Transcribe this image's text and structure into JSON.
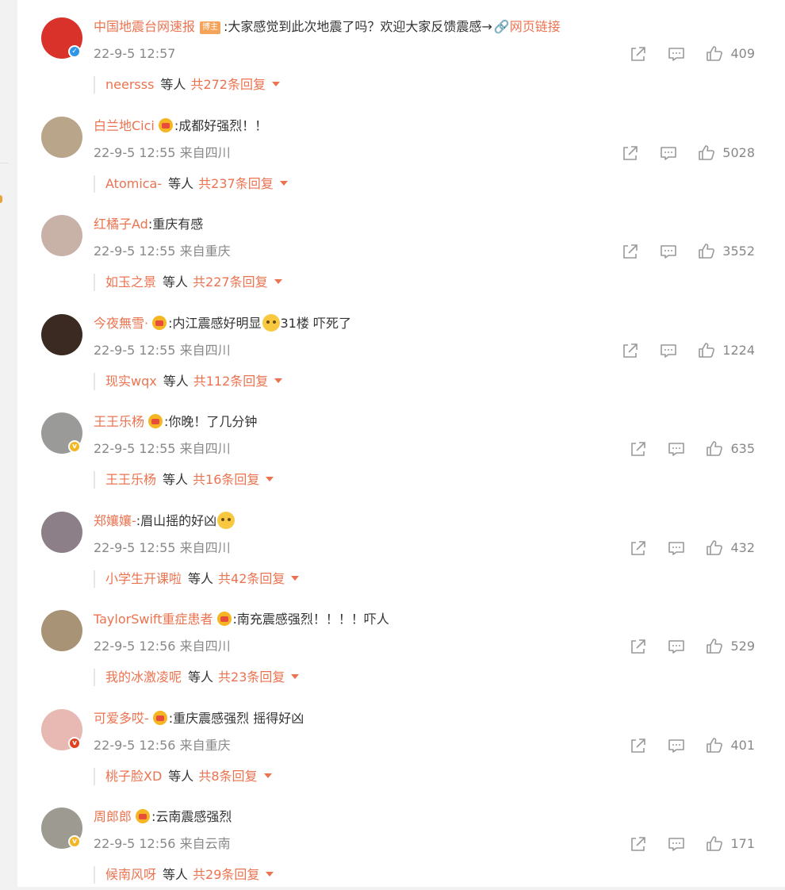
{
  "comments": [
    {
      "user": "中国地震台网速报",
      "tag": "博主",
      "text": ":大家感觉到此次地震了吗？欢迎大家反馈震感→",
      "link": "网页链接",
      "time": "22-9-5 12:57",
      "location": "",
      "likes": "409",
      "reply_user": "neersss",
      "reply_mid": "等人",
      "reply_total": "共272条回复",
      "badge": "blue",
      "crown": false,
      "avatar_color": "#d8322b"
    },
    {
      "user": "白兰地Cici",
      "tag": "",
      "text": ":成都好强烈！！",
      "link": "",
      "time": "22-9-5 12:55",
      "location": "来自四川",
      "likes": "5028",
      "reply_user": "Atomica-",
      "reply_mid": "等人",
      "reply_total": "共237条回复",
      "badge": "",
      "crown": true,
      "avatar_color": "#b9a58a"
    },
    {
      "user": "红橘子Ad",
      "tag": "",
      "text": ":重庆有感",
      "link": "",
      "time": "22-9-5 12:55",
      "location": "来自重庆",
      "likes": "3552",
      "reply_user": "如玉之景",
      "reply_mid": "等人",
      "reply_total": "共227条回复",
      "badge": "",
      "crown": false,
      "avatar_color": "#c8b2a8"
    },
    {
      "user": "今夜無雪·",
      "tag": "",
      "text": ":内江震感好明显",
      "text2": "31楼 吓死了",
      "link": "",
      "time": "22-9-5 12:55",
      "location": "来自四川",
      "likes": "1224",
      "reply_user": "现实wqx",
      "reply_mid": "等人",
      "reply_total": "共112条回复",
      "badge": "",
      "crown": true,
      "emoji": true,
      "avatar_color": "#3a2a22"
    },
    {
      "user": "王王乐杨",
      "tag": "",
      "text": ":你晚！了几分钟",
      "link": "",
      "time": "22-9-5 12:55",
      "location": "来自四川",
      "likes": "635",
      "reply_user": "王王乐杨",
      "reply_mid": "等人",
      "reply_total": "共16条回复",
      "badge": "gold",
      "crown": true,
      "avatar_color": "#9a9a98"
    },
    {
      "user": "郑孃孃-",
      "tag": "",
      "text": ":眉山摇的好凶",
      "link": "",
      "time": "22-9-5 12:55",
      "location": "来自四川",
      "likes": "432",
      "reply_user": "小学生开课啦",
      "reply_mid": "等人",
      "reply_total": "共42条回复",
      "badge": "",
      "crown": false,
      "emoji_end": true,
      "avatar_color": "#8c7f88"
    },
    {
      "user": "TaylorSwift重症患者",
      "tag": "",
      "text": ":南充震感强烈！！！！吓人",
      "link": "",
      "time": "22-9-5 12:56",
      "location": "来自四川",
      "likes": "529",
      "reply_user": "我的冰激凌呢",
      "reply_mid": "等人",
      "reply_total": "共23条回复",
      "badge": "",
      "crown": true,
      "avatar_color": "#a89377"
    },
    {
      "user": "可爱多哎-",
      "tag": "",
      "text": ":重庆震感强烈 摇得好凶",
      "link": "",
      "time": "22-9-5 12:56",
      "location": "来自重庆",
      "likes": "401",
      "reply_user": "桃子脸XD",
      "reply_mid": "等人",
      "reply_total": "共8条回复",
      "badge": "red",
      "crown": true,
      "avatar_color": "#e8b8b2"
    },
    {
      "user": "周郎郎",
      "tag": "",
      "text": ":云南震感强烈",
      "link": "",
      "time": "22-9-5 12:56",
      "location": "来自云南",
      "likes": "171",
      "reply_user": "候南风呀",
      "reply_mid": "等人",
      "reply_total": "共29条回复",
      "badge": "gold",
      "crown": true,
      "avatar_color": "#9d9a92"
    }
  ],
  "icons": {
    "share": "share-icon",
    "comment": "comment-icon",
    "like": "like-icon"
  },
  "colors": {
    "accent": "#eb7350",
    "meta": "#888888",
    "text": "#333333"
  }
}
